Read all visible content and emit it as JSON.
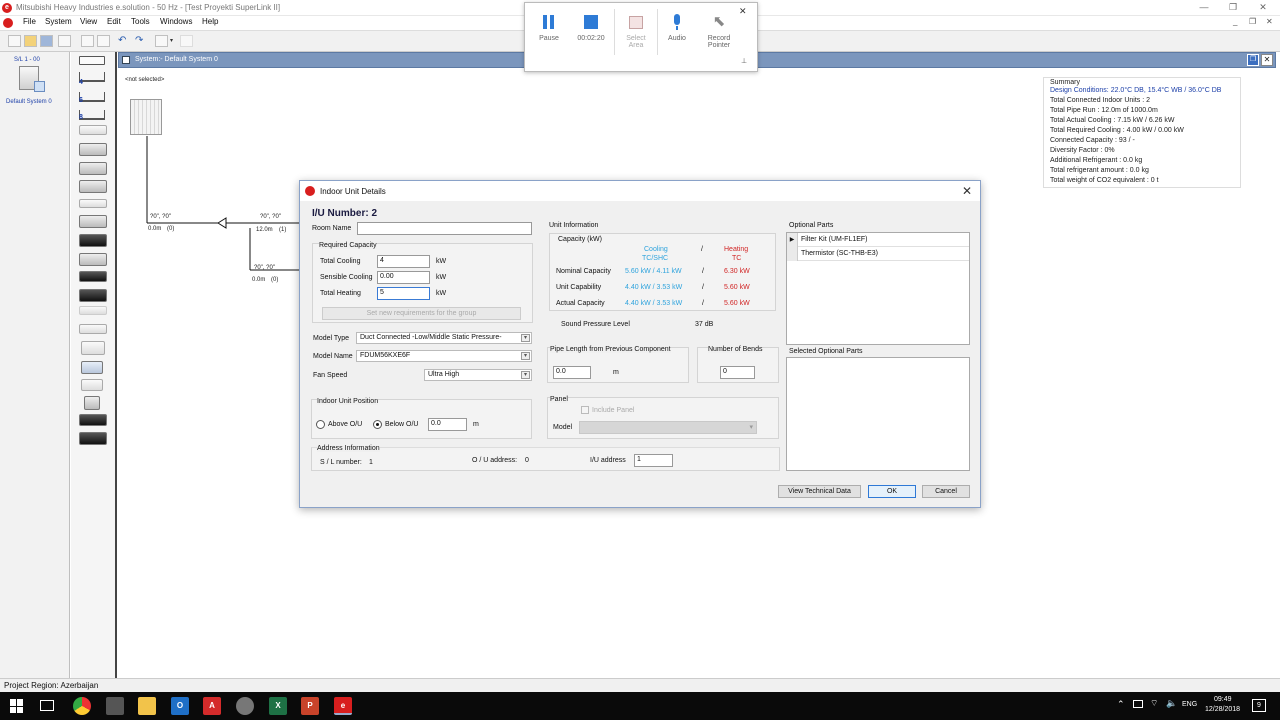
{
  "window": {
    "title": "Mitsubishi Heavy Industries e.solution - 50 Hz - [Test Proyekti  SuperLink II]"
  },
  "menu": [
    "File",
    "System",
    "View",
    "Edit",
    "Tools",
    "Windows",
    "Help"
  ],
  "left_panel": {
    "tree_label": "S/L 1 - 00",
    "system_label": "Default System 0"
  },
  "icon_badges": [
    "4",
    "6",
    "8"
  ],
  "system_header": {
    "label": "System:- Default System 0"
  },
  "canvas": {
    "not_selected": "<not selected>",
    "dims": [
      {
        "h": "?0\", ?0\"",
        "len": "0.0m",
        "n": "(0)"
      },
      {
        "h": "?0\", ?0\"",
        "len": "12.0m",
        "n": "(1)"
      },
      {
        "h": "?0\", ?0\"",
        "len": "0.0m",
        "n": "(0)"
      }
    ]
  },
  "summary": {
    "heading": "Summary",
    "lines": [
      "Design Conditions: 22.0°C DB, 15.4°C WB / 36.0°C DB",
      "Total Connected Indoor Units : 2",
      "Total Pipe Run : 12.0m of 1000.0m",
      "Total Actual Cooling : 7.15 kW / 6.26 kW",
      "Total Required Cooling : 4.00 kW / 0.00 kW",
      "Connected Capacity : 93 / -",
      "Diversity Factor : 0%",
      "Additional Refrigerant : 0.0 kg",
      "Total refrigerant amount : 0.0 kg",
      "Total weight of CO2 equivalent : 0 t"
    ]
  },
  "recorder": {
    "pause": "Pause",
    "time": "00:02:20",
    "select_area": [
      "Select",
      "Area"
    ],
    "audio": "Audio",
    "record_pointer": [
      "Record",
      "Pointer"
    ]
  },
  "dialog": {
    "title": "Indoor Unit Details",
    "iu_number": "I/U Number: 2",
    "room_name_label": "Room Name",
    "room_name_value": "",
    "required_capacity": {
      "title": "Required Capacity",
      "rows": [
        {
          "label": "Total Cooling",
          "value": "4",
          "unit": "kW"
        },
        {
          "label": "Sensible Cooling",
          "value": "0.00",
          "unit": "kW"
        },
        {
          "label": "Total Heating",
          "value": "5",
          "unit": "kW"
        }
      ],
      "button": "Set new requirements for the group"
    },
    "model_type_label": "Model Type",
    "model_type_value": "Duct Connected -Low/Middle Static Pressure-",
    "model_name_label": "Model Name",
    "model_name_value": "FDUM56KXE6F",
    "fan_speed_label": "Fan Speed",
    "fan_speed_value": "Ultra High",
    "unit_position": {
      "title": "Indoor Unit Position",
      "above": "Above O/U",
      "below": "Below O/U",
      "value": "0.0",
      "unit": "m",
      "selected": "below"
    },
    "address": {
      "title": "Address Information",
      "sl_label": "S / L number:",
      "sl_value": "1",
      "ou_label": "O / U address:",
      "ou_value": "0",
      "iu_label": "I/U address",
      "iu_value": "1"
    },
    "unit_info": {
      "title": "Unit Information",
      "capacity_title": "Capacity (kW)",
      "cool_head": [
        "Cooling",
        "TC/SHC"
      ],
      "sep": "/",
      "heat_head": [
        "Heating",
        "TC"
      ],
      "rows": [
        {
          "label": "Nominal Capacity",
          "cool": "5.60 kW / 4.11 kW",
          "heat": "6.30 kW"
        },
        {
          "label": "Unit Capability",
          "cool": "4.40 kW / 3.53 kW",
          "heat": "5.60 kW"
        },
        {
          "label": "Actual Capacity",
          "cool": "4.40 kW / 3.53 kW",
          "heat": "5.60 kW"
        }
      ],
      "spl_label": "Sound Pressure Level",
      "spl_value": "37 dB"
    },
    "pipe": {
      "title": "Pipe Length from Previous Component",
      "value": "0.0",
      "unit": "m"
    },
    "bends": {
      "title": "Number of Bends",
      "value": "0"
    },
    "panel": {
      "title": "Panel",
      "include": "Include Panel",
      "model_label": "Model"
    },
    "optional_parts": {
      "title": "Optional Parts",
      "items": [
        "Filter Kit (UM-FL1EF)",
        "Thermistor (SC-THB-E3)"
      ]
    },
    "selected_parts": {
      "title": "Selected Optional Parts"
    },
    "buttons": {
      "tech": "View Technical Data",
      "ok": "OK",
      "cancel": "Cancel"
    }
  },
  "status": {
    "text": "Project Region: Azerbaijan"
  },
  "taskbar": {
    "lang": "ENG",
    "time": "09:49",
    "date": "12/28/2018",
    "notif": "9"
  }
}
